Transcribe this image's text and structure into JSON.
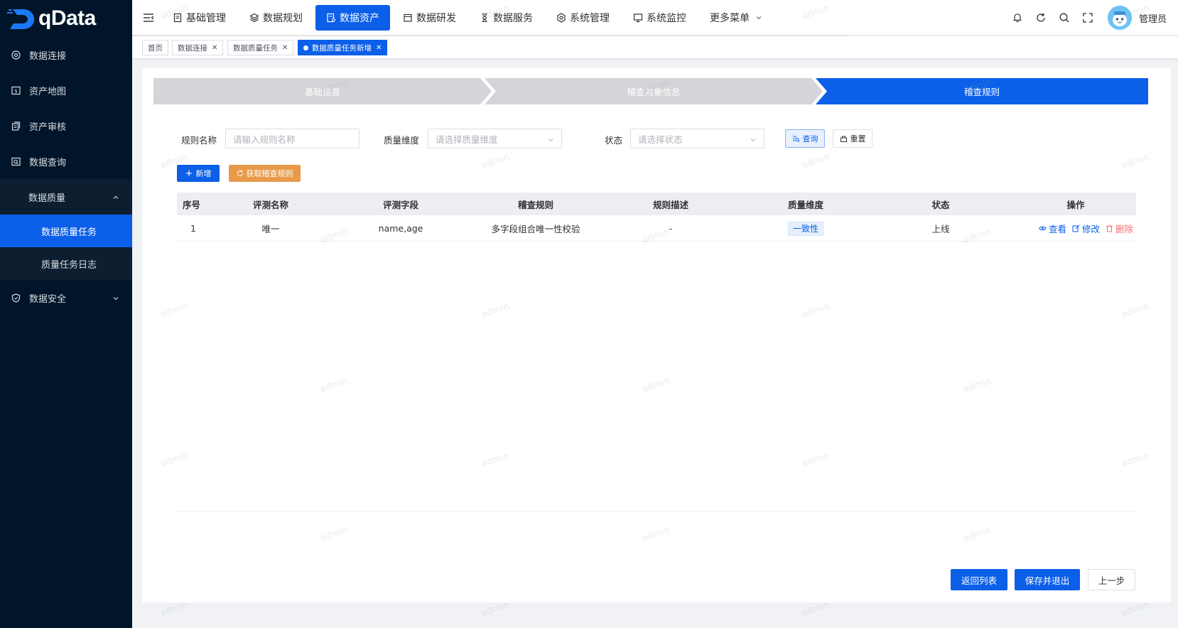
{
  "app": {
    "logo_text": "qData"
  },
  "sidebar": {
    "items": [
      {
        "label": "数据连接",
        "icon": "target-icon"
      },
      {
        "label": "资产地图",
        "icon": "map-icon"
      },
      {
        "label": "资产审核",
        "icon": "audit-icon"
      },
      {
        "label": "数据查询",
        "icon": "query-icon"
      }
    ],
    "quality_group": {
      "label": "数据质量",
      "children": [
        {
          "label": "数据质量任务",
          "active": true
        },
        {
          "label": "质量任务日志",
          "active": false
        }
      ]
    },
    "security_group": {
      "label": "数据安全"
    }
  },
  "topnav": {
    "items": [
      {
        "label": "基础管理"
      },
      {
        "label": "数据规划"
      },
      {
        "label": "数据资产",
        "active": true
      },
      {
        "label": "数据研发"
      },
      {
        "label": "数据服务"
      },
      {
        "label": "系统管理"
      },
      {
        "label": "系统监控"
      },
      {
        "label": "更多菜单"
      }
    ],
    "user_name": "管理员"
  },
  "tags": [
    {
      "label": "首页"
    },
    {
      "label": "数据连接"
    },
    {
      "label": "数据质量任务"
    },
    {
      "label": "数据质量任务新增",
      "active": true
    }
  ],
  "steps": [
    {
      "label": "基础信息"
    },
    {
      "label": "稽查对象信息"
    },
    {
      "label": "稽查规则"
    }
  ],
  "filters": {
    "rule_name_label": "规则名称",
    "rule_name_placeholder": "请输入规则名称",
    "dimension_label": "质量维度",
    "dimension_placeholder": "请选择质量维度",
    "status_label": "状态",
    "status_placeholder": "请选择状态",
    "query_btn": "查询",
    "reset_btn": "重置"
  },
  "actions": {
    "add_btn": "新增",
    "fetch_btn": "获取稽查规则"
  },
  "table": {
    "columns": [
      "序号",
      "评测名称",
      "评测字段",
      "稽查规则",
      "规则描述",
      "质量维度",
      "状态",
      "操作"
    ],
    "rows": [
      {
        "index": "1",
        "name": "唯一",
        "fields": "name,age",
        "rule": "多字段组合唯一性校验",
        "desc": "-",
        "dimension": "一致性",
        "status": "上线",
        "ops": {
          "view": "查看",
          "edit": "修改",
          "delete": "删除"
        }
      }
    ]
  },
  "footer": {
    "back_btn": "返回列表",
    "save_btn": "保存并退出",
    "prev_btn": "上一步"
  },
  "watermark": "admin",
  "colors": {
    "primary": "#0b5fe8",
    "sidebar_bg": "#001529",
    "warning": "#e89a4a",
    "danger": "#f56c6c"
  }
}
